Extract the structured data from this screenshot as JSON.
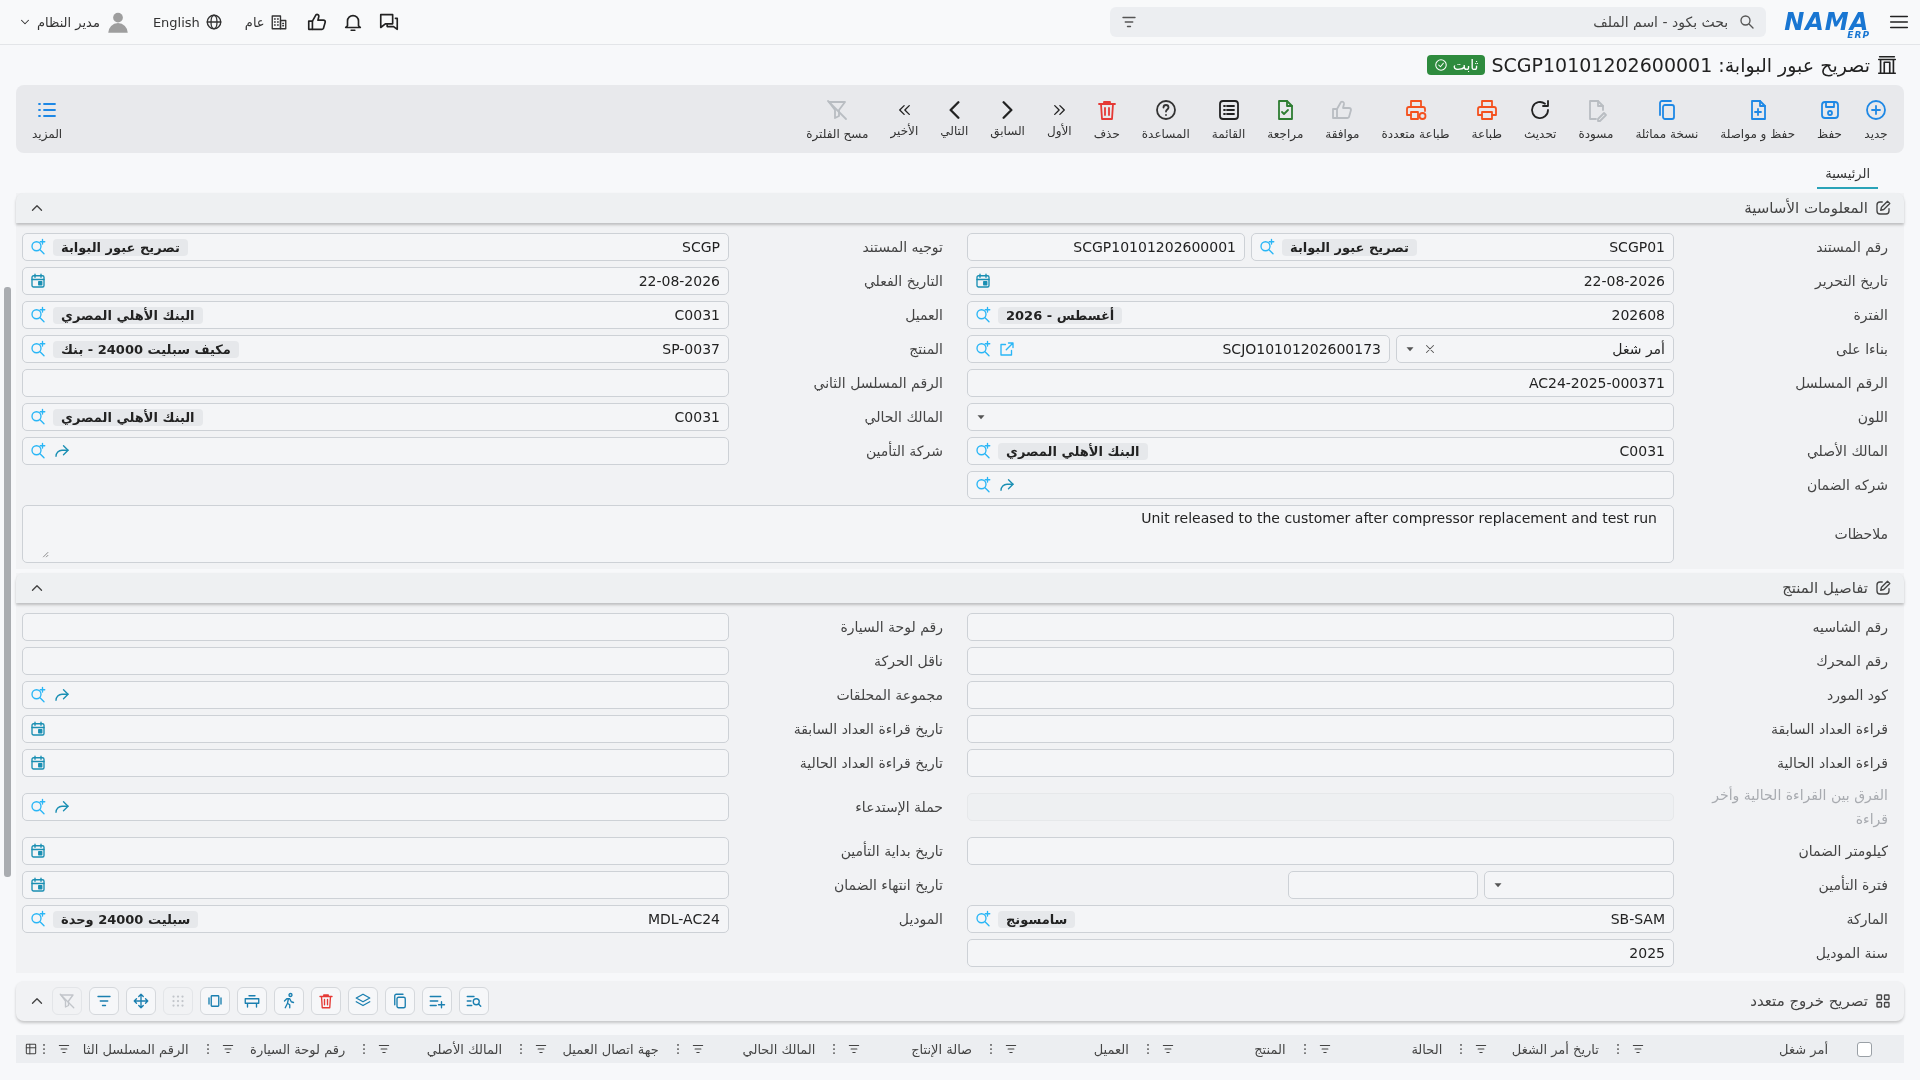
{
  "topbar": {
    "logo": {
      "name": "NAMA",
      "suffix": "ERP"
    },
    "search": {
      "placeholder": "بحث بكود - اسم الملف"
    },
    "branch": "عام",
    "language": "English",
    "user": "مدير النظام"
  },
  "title": {
    "text": "تصريح عبور البوابة: SCGP10101202600001",
    "status": "ثابت"
  },
  "toolbar": [
    {
      "label": "جديد",
      "disabled": false
    },
    {
      "label": "حفظ",
      "disabled": false
    },
    {
      "label": "حفظ و مواصلة",
      "disabled": false
    },
    {
      "label": "نسخة مماثلة",
      "disabled": false
    },
    {
      "label": "مسودة",
      "disabled": true
    },
    {
      "label": "تحديث",
      "disabled": false
    },
    {
      "label": "طباعة",
      "disabled": false
    },
    {
      "label": "طباعة متعددة",
      "disabled": false
    },
    {
      "label": "موافقة",
      "disabled": true
    },
    {
      "label": "مراجعة",
      "disabled": false
    },
    {
      "label": "القائمة",
      "disabled": false
    },
    {
      "label": "المساعدة",
      "disabled": false
    },
    {
      "label": "حذف",
      "disabled": false
    },
    {
      "label": "الأول",
      "disabled": false
    },
    {
      "label": "السابق",
      "disabled": false
    },
    {
      "label": "التالي",
      "disabled": false
    },
    {
      "label": "الأخير",
      "disabled": false
    },
    {
      "label": "مسح الفلترة",
      "disabled": true
    }
  ],
  "more": {
    "label": "المزيد"
  },
  "tabs": [
    {
      "label": "الرئيسية",
      "selected": true
    }
  ],
  "sections": [
    {
      "title": "المعلومات الأساسية",
      "expanded": true,
      "rows": [
        {
          "right": {
            "kind": "split",
            "label": "رقم المستند",
            "value": "SCGP01",
            "tag": "تصريح عبور البوابة",
            "number": "SCGP10101202600001"
          },
          "left": {
            "kind": "lookup",
            "label": "توجيه المستند",
            "value": "SCGP",
            "tag": "تصريح عبور البوابة"
          }
        },
        {
          "right": {
            "kind": "date",
            "label": "تاريخ التحرير",
            "value": "22-08-2026"
          },
          "left": {
            "kind": "date",
            "label": "التاريخ الفعلي",
            "value": "22-08-2026"
          }
        },
        {
          "right": {
            "kind": "lookup",
            "label": "الفترة",
            "value": "202608",
            "tag": "أغسطس - 2026"
          },
          "left": {
            "kind": "lookup",
            "label": "العميل",
            "value": "C0031",
            "tag": "البنك الأهلي المصري"
          }
        },
        {
          "right": {
            "kind": "reference",
            "label": "بناءا على",
            "choice": "أمر شغل",
            "value": "SCJO10101202600173"
          },
          "left": {
            "kind": "lookup",
            "label": "المنتج",
            "value": "SP-0037",
            "tag": "مكيف سبليت 24000 - بنك"
          }
        },
        {
          "right": {
            "kind": "text",
            "label": "الرقم المسلسل",
            "value": "AC24-2025-000371"
          },
          "left": {
            "kind": "text",
            "label": "الرقم المسلسل الثاني"
          }
        },
        {
          "right": {
            "kind": "select",
            "label": "اللون"
          },
          "left": {
            "kind": "lookup",
            "label": "المالك الحالي",
            "value": "C0031",
            "tag": "البنك الأهلي المصري"
          }
        },
        {
          "right": {
            "kind": "lookup",
            "label": "المالك الأصلي",
            "value": "C0031",
            "tag": "البنك الأهلي المصري"
          },
          "left": {
            "kind": "link",
            "label": "شركة التأمين"
          }
        },
        {
          "right": {
            "kind": "link",
            "label": "شركه الضمان"
          }
        },
        {
          "full": {
            "kind": "textarea",
            "label": "ملاحظات",
            "value": "Unit released to the customer after compressor replacement and test run"
          }
        }
      ]
    },
    {
      "title": "تفاصيل المنتج",
      "expanded": true,
      "rows": [
        {
          "right": {
            "kind": "text",
            "label": "رقم الشاسيه"
          },
          "left": {
            "kind": "text",
            "label": "رقم لوحة السيارة"
          }
        },
        {
          "right": {
            "kind": "text",
            "label": "رقم المحرك"
          },
          "left": {
            "kind": "text",
            "label": "ناقل الحركة"
          }
        },
        {
          "right": {
            "kind": "text",
            "label": "كود المورد"
          },
          "left": {
            "kind": "link",
            "label": "مجموعة المحلقات"
          }
        },
        {
          "right": {
            "kind": "text",
            "label": "قراءة العداد السابقة"
          },
          "left": {
            "kind": "date",
            "label": "تاريخ قراءة العداد السابقة"
          }
        },
        {
          "right": {
            "kind": "text",
            "label": "قراءة العداد الحالية"
          },
          "left": {
            "kind": "date",
            "label": "تاريخ قراءة العداد الحالية"
          }
        },
        {
          "right": {
            "kind": "readonly",
            "label": "الفرق بين القراءة الحالية وأخر قراءة"
          },
          "left": {
            "kind": "link",
            "label": "حملة الإستدعاء"
          }
        },
        {
          "right": {
            "kind": "text",
            "label": "كيلومتر الضمان"
          },
          "left": {
            "kind": "date",
            "label": "تاريخ بداية التأمين"
          }
        },
        {
          "right": {
            "kind": "select-pair",
            "label": "فترة التأمين"
          },
          "left": {
            "kind": "date",
            "label": "تاريخ انتهاء الضمان"
          }
        },
        {
          "right": {
            "kind": "lookup",
            "label": "الماركة",
            "value": "SB-SAM",
            "tag": "سامسونج"
          },
          "left": {
            "kind": "lookup",
            "label": "الموديل",
            "value": "MDL-AC24",
            "tag": "سبليت 24000 وحدة"
          }
        },
        {
          "right": {
            "kind": "text",
            "label": "سنة الموديل",
            "value": "2025"
          }
        }
      ]
    }
  ],
  "grid": {
    "title": "تصريح خروج متعدد",
    "expanded": true,
    "tools": [
      {
        "disabled": false
      },
      {
        "disabled": false
      },
      {
        "disabled": false
      },
      {
        "disabled": false
      },
      {
        "disabled": false
      },
      {
        "disabled": false
      },
      {
        "disabled": false
      },
      {
        "disabled": false
      },
      {
        "disabled": true
      },
      {
        "disabled": false
      },
      {
        "disabled": false
      },
      {
        "disabled": true
      }
    ],
    "select_all": {
      "checked": false
    },
    "columns": [
      {
        "label": "أمر شغل"
      },
      {
        "label": "تاريخ أمر الشغل"
      },
      {
        "label": "الحالة"
      },
      {
        "label": "المنتج"
      },
      {
        "label": "العميل"
      },
      {
        "label": "صالة الإنتاج"
      },
      {
        "label": "المالك الحالي"
      },
      {
        "label": "جهة اتصال العميل"
      },
      {
        "label": "المالك الأصلي"
      },
      {
        "label": "رقم لوحة السيارة"
      },
      {
        "label": "الرقم المسلسل الثا"
      }
    ]
  }
}
